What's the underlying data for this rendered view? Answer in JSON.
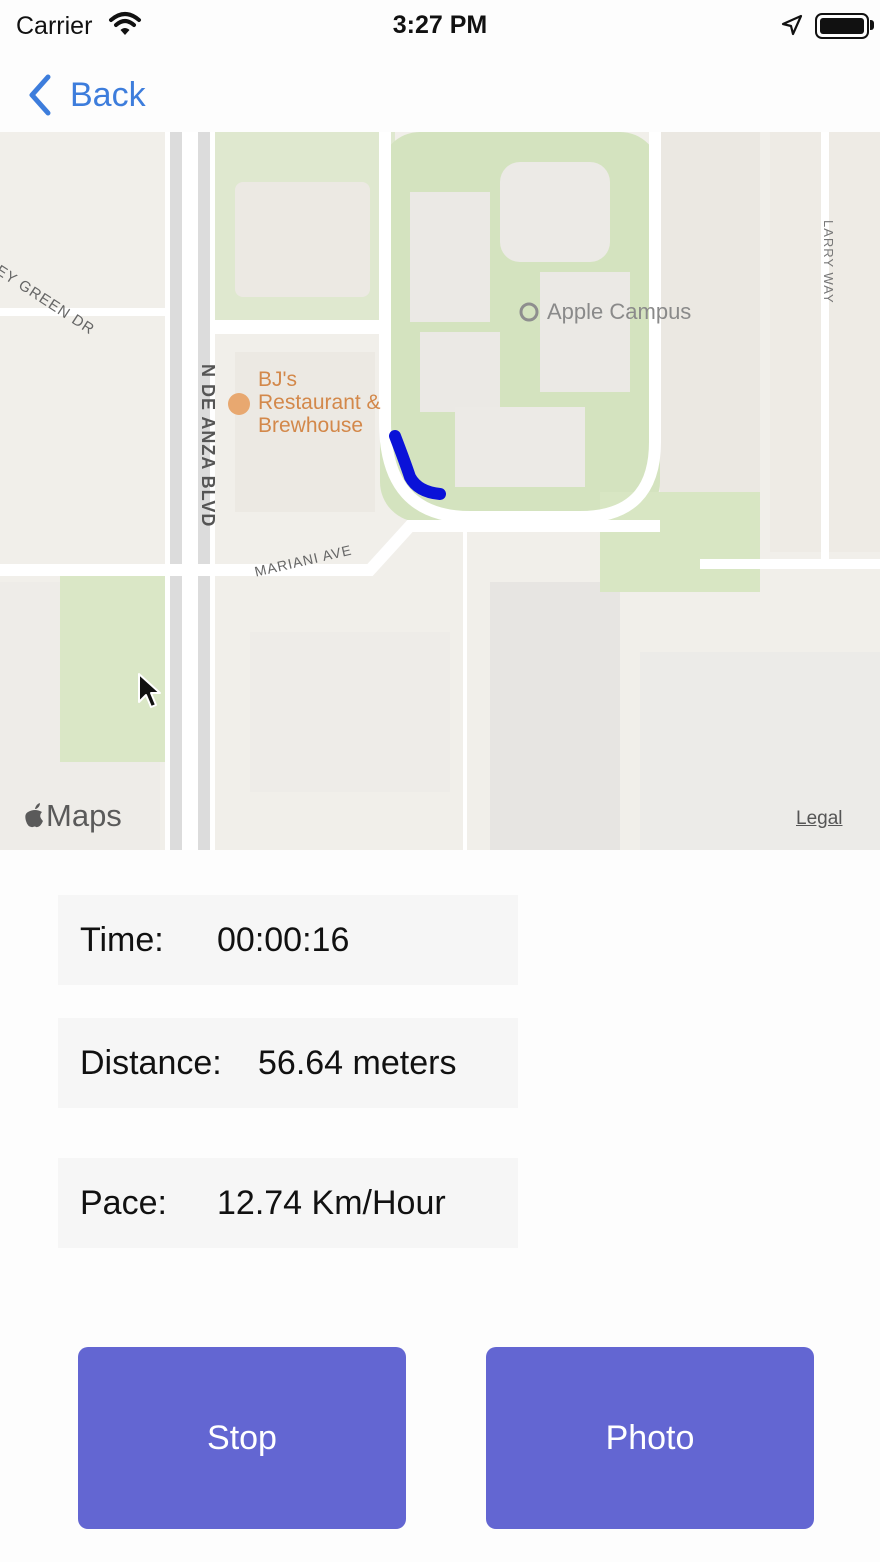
{
  "status_bar": {
    "carrier": "Carrier",
    "time": "3:27 PM",
    "icons": [
      "wifi-icon",
      "location-arrow-icon",
      "battery-icon"
    ]
  },
  "nav": {
    "back_label": "Back",
    "back_icon": "chevron-left-icon"
  },
  "map": {
    "labels": {
      "street_green": "EY GREEN DR",
      "de_anza": "N DE ANZA BLVD",
      "mariani": "MARIANI AVE",
      "larry_way": "LARRY WAY",
      "poi_apple": "Apple Campus",
      "poi_bjs_line1": "BJ's",
      "poi_bjs_line2": "Restaurant &",
      "poi_bjs_line3": "Brewhouse"
    },
    "attribution": "Maps",
    "legal": "Legal",
    "route_color": "#0a12d8"
  },
  "stats": {
    "time_label": "Time:",
    "time_value": "00:00:16",
    "distance_label": "Distance:",
    "distance_value": "56.64 meters",
    "pace_label": "Pace:",
    "pace_value": "12.74 Km/Hour"
  },
  "buttons": {
    "stop_label": "Stop",
    "photo_label": "Photo"
  },
  "colors": {
    "accent": "#3d7ddc",
    "button": "#6366d2"
  }
}
